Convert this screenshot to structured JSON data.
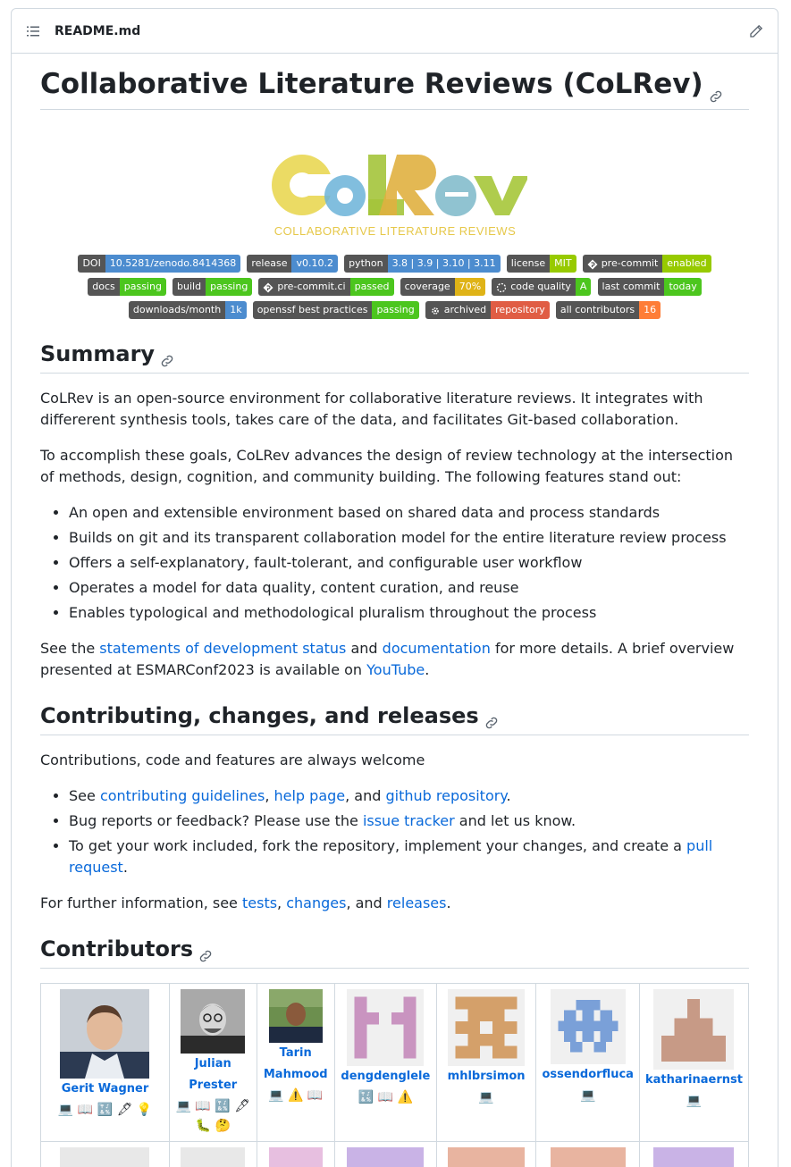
{
  "file": {
    "name": "README.md"
  },
  "title": "Collaborative Literature Reviews (CoLRev)",
  "logo": {
    "wordmark": "CoLRev",
    "tagline": "COLLABORATIVE LITERATURE REVIEWS"
  },
  "badges": {
    "row1": [
      {
        "label": "DOI",
        "value": "10.5281/zenodo.8414368",
        "color": "#4c8ccf"
      },
      {
        "label": "release",
        "value": "v0.10.2",
        "color": "#4c8ccf"
      },
      {
        "label": "python",
        "value": "3.8 | 3.9 | 3.10 | 3.11",
        "color": "#4c8ccf"
      },
      {
        "label": "license",
        "value": "MIT",
        "color": "#97ca00"
      },
      {
        "label": "pre-commit",
        "value": "enabled",
        "color": "#97ca00"
      }
    ],
    "row2": [
      {
        "label": "docs",
        "value": "passing",
        "color": "#4cc61e"
      },
      {
        "label": "build",
        "value": "passing",
        "color": "#4cc61e"
      },
      {
        "label": "pre-commit.ci",
        "value": "passed",
        "color": "#4cc61e"
      },
      {
        "label": "coverage",
        "value": "70%",
        "color": "#dfb317"
      },
      {
        "label": "code quality",
        "value": "A",
        "color": "#4cc61e"
      },
      {
        "label": "last commit",
        "value": "today",
        "color": "#4cc61e"
      }
    ],
    "row3": [
      {
        "label": "downloads/month",
        "value": "1k",
        "color": "#4c8ccf"
      },
      {
        "label": "openssf best practices",
        "value": "passing",
        "color": "#4cc61e"
      },
      {
        "label": "archived",
        "value": "repository",
        "color": "#e05d44"
      },
      {
        "label": "all contributors",
        "value": "16",
        "color": "#fe7d37"
      }
    ]
  },
  "summary": {
    "heading": "Summary",
    "p1": "CoLRev is an open-source environment for collaborative literature reviews. It integrates with differerent synthesis tools, takes care of the data, and facilitates Git-based collaboration.",
    "p2": "To accomplish these goals, CoLRev advances the design of review technology at the intersection of methods, design, cognition, and community building. The following features stand out:",
    "features": [
      "An open and extensible environment based on shared data and process standards",
      "Builds on git and its transparent collaboration model for the entire literature review process",
      "Offers a self-explanatory, fault-tolerant, and configurable user workflow",
      "Operates a model for data quality, content curation, and reuse",
      "Enables typological and methodological pluralism throughout the process"
    ],
    "p3_pre": "See the ",
    "p3_link1": "statements of development status",
    "p3_mid1": " and ",
    "p3_link2": "documentation",
    "p3_mid2": " for more details. A brief overview presented at ESMARConf2023 is available on ",
    "p3_link3": "YouTube",
    "p3_end": "."
  },
  "contributing": {
    "heading": "Contributing, changes, and releases",
    "intro": "Contributions, code and features are always welcome",
    "item1": {
      "pre": "See ",
      "l1": "contributing guidelines",
      "s1": ", ",
      "l2": "help page",
      "s2": ", and ",
      "l3": "github repository",
      "end": "."
    },
    "item2": {
      "pre": "Bug reports or feedback? Please use the ",
      "l1": "issue tracker",
      "end": " and let us know."
    },
    "item3": {
      "pre": "To get your work included, fork the repository, implement your changes, and create a ",
      "l1": "pull request",
      "end": "."
    },
    "further": {
      "pre": "For further information, see ",
      "l1": "tests",
      "s1": ", ",
      "l2": "changes",
      "s2": ", and ",
      "l3": "releases",
      "end": "."
    }
  },
  "contributors": {
    "heading": "Contributors",
    "people": [
      {
        "name": "Gerit Wagner",
        "emojis": "💻 📖 🔣 🖋 💡"
      },
      {
        "name": "Julian Prester",
        "emojis": "💻 📖 🔣 🖋 🐛 🤔"
      },
      {
        "name": "Tarin Mahmood",
        "emojis": "💻 ⚠️ 📖"
      },
      {
        "name": "dengdenglele",
        "emojis": "🔣 📖 ⚠️"
      },
      {
        "name": "mhlbrsimon",
        "emojis": "💻"
      },
      {
        "name": "ossendorfluca",
        "emojis": "💻"
      },
      {
        "name": "katharinaernst",
        "emojis": "💻"
      }
    ]
  }
}
